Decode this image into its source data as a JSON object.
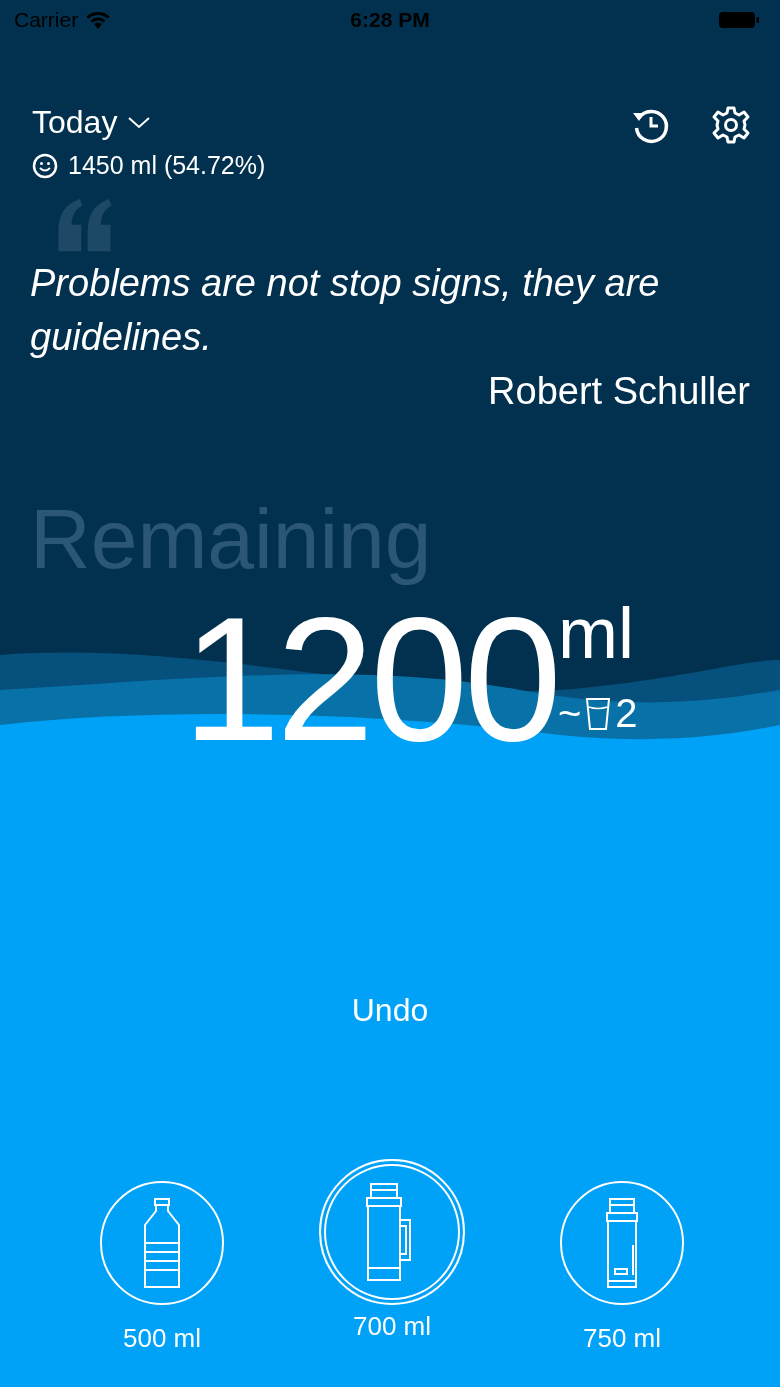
{
  "status_bar": {
    "carrier": "Carrier",
    "time": "6:28 PM"
  },
  "header": {
    "day": "Today",
    "summary": "1450 ml (54.72%)"
  },
  "quote": {
    "text": "Problems are not stop signs, they are guidelines.",
    "author": "Robert Schuller"
  },
  "remaining": {
    "label": "Remaining",
    "amount": "1200",
    "unit": "ml",
    "approx": "~",
    "cups": "2"
  },
  "undo": "Undo",
  "containers": [
    {
      "kind": "bottle",
      "label": "500 ml",
      "selected": false
    },
    {
      "kind": "thermos",
      "label": "700 ml",
      "selected": true
    },
    {
      "kind": "flask",
      "label": "750 ml",
      "selected": false
    }
  ]
}
